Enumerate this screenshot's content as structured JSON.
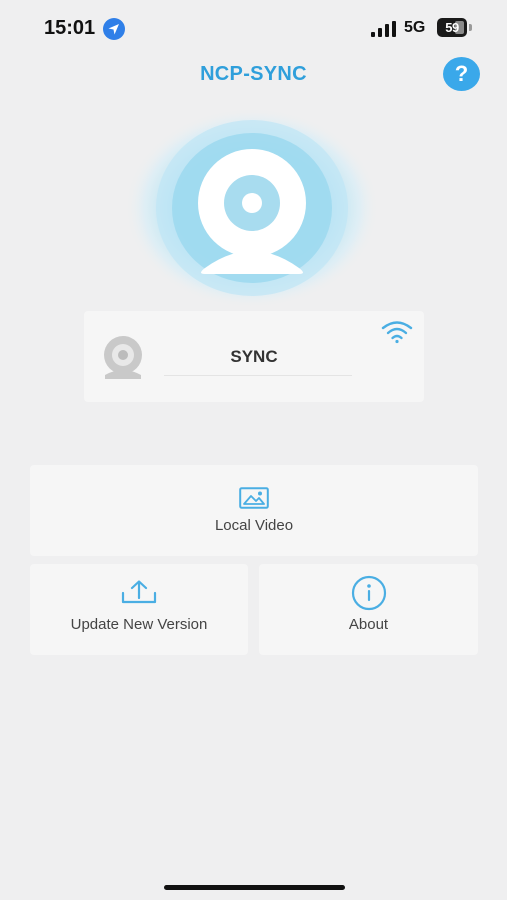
{
  "status_bar": {
    "time": "15:01",
    "network": "5G",
    "battery": "59",
    "icons": [
      "location-arrow-icon",
      "cellular-signal-icon",
      "battery-icon"
    ]
  },
  "header": {
    "title": "NCP-SYNC",
    "help_label": "?"
  },
  "device": {
    "name": "SYNC",
    "icons": [
      "camera-thumbnail-icon",
      "wifi-icon"
    ]
  },
  "menu": {
    "local_video": "Local Video",
    "update": "Update New Version",
    "about": "About"
  },
  "colors": {
    "accent": "#2f9fdb",
    "help_bg": "#3aa8ea",
    "background": "#efeff0",
    "card": "#f6f6f6"
  }
}
